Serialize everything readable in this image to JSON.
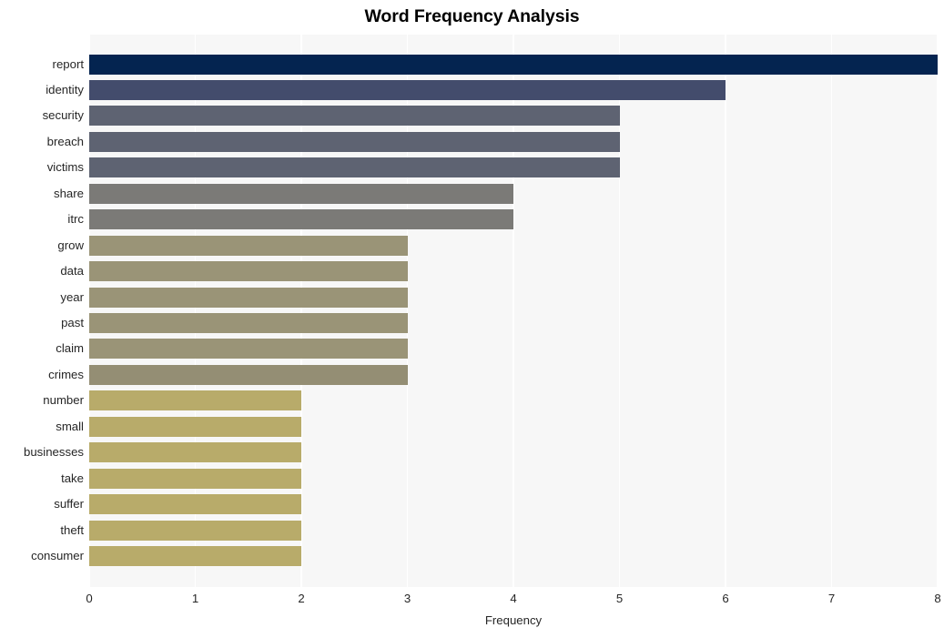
{
  "chart_data": {
    "type": "bar",
    "orientation": "horizontal",
    "title": "Word Frequency Analysis",
    "xlabel": "Frequency",
    "ylabel": "",
    "xlim": [
      0,
      8
    ],
    "xticks": [
      "0",
      "1",
      "2",
      "3",
      "4",
      "5",
      "6",
      "7",
      "8"
    ],
    "xtick_values": [
      0,
      1,
      2,
      3,
      4,
      5,
      6,
      7,
      8
    ],
    "grid": true,
    "grid_axis": "x",
    "legend": "none",
    "plot_background": "#f7f7f7",
    "gridline_color": "#ffffff",
    "categories": [
      "report",
      "identity",
      "security",
      "breach",
      "victims",
      "share",
      "itrc",
      "grow",
      "data",
      "year",
      "past",
      "claim",
      "crimes",
      "number",
      "small",
      "businesses",
      "take",
      "suffer",
      "theft",
      "consumer"
    ],
    "values": [
      8,
      6,
      5,
      5,
      5,
      4,
      4,
      3,
      3,
      3,
      3,
      3,
      3,
      2,
      2,
      2,
      2,
      2,
      2,
      2
    ],
    "bar_colors": [
      "#042450",
      "#434c6c",
      "#5e6372",
      "#5e6372",
      "#5e6372",
      "#7b7a77",
      "#7b7a77",
      "#9a9477",
      "#9a9477",
      "#9a9477",
      "#9a9477",
      "#9a9477",
      "#948e74",
      "#b8ab6a",
      "#b8ab6a",
      "#b8ab6a",
      "#b8ab6a",
      "#b8ab6a",
      "#b8ab6a",
      "#b8ab6a"
    ],
    "bars": [
      {
        "label": "report",
        "value": 8,
        "color": "#042450"
      },
      {
        "label": "identity",
        "value": 6,
        "color": "#434c6c"
      },
      {
        "label": "security",
        "value": 5,
        "color": "#5e6372"
      },
      {
        "label": "breach",
        "value": 5,
        "color": "#5e6372"
      },
      {
        "label": "victims",
        "value": 5,
        "color": "#5e6372"
      },
      {
        "label": "share",
        "value": 4,
        "color": "#7b7a77"
      },
      {
        "label": "itrc",
        "value": 4,
        "color": "#7b7a77"
      },
      {
        "label": "grow",
        "value": 3,
        "color": "#9a9477"
      },
      {
        "label": "data",
        "value": 3,
        "color": "#9a9477"
      },
      {
        "label": "year",
        "value": 3,
        "color": "#9a9477"
      },
      {
        "label": "past",
        "value": 3,
        "color": "#9a9477"
      },
      {
        "label": "claim",
        "value": 3,
        "color": "#9a9477"
      },
      {
        "label": "crimes",
        "value": 3,
        "color": "#948e74"
      },
      {
        "label": "number",
        "value": 2,
        "color": "#b8ab6a"
      },
      {
        "label": "small",
        "value": 2,
        "color": "#b8ab6a"
      },
      {
        "label": "businesses",
        "value": 2,
        "color": "#b8ab6a"
      },
      {
        "label": "take",
        "value": 2,
        "color": "#b8ab6a"
      },
      {
        "label": "suffer",
        "value": 2,
        "color": "#b8ab6a"
      },
      {
        "label": "theft",
        "value": 2,
        "color": "#b8ab6a"
      },
      {
        "label": "consumer",
        "value": 2,
        "color": "#b8ab6a"
      }
    ]
  }
}
